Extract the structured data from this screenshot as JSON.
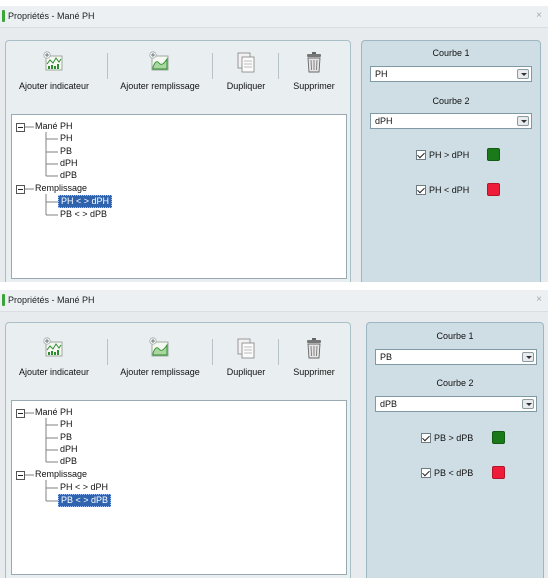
{
  "dialogs": [
    {
      "title": "Propriétés - Mané PH",
      "close": "×",
      "toolbar": {
        "add_indicator": "Ajouter indicateur",
        "add_fill": "Ajouter remplissage",
        "duplicate": "Dupliquer",
        "delete": "Supprimer"
      },
      "tree": {
        "root": "Mané PH",
        "children": [
          "PH",
          "PB",
          "dPH",
          "dPB"
        ],
        "fill_root": "Remplissage",
        "fill_children": [
          "PH < > dPH",
          "PB < > dPB"
        ],
        "selected_fill": 0
      },
      "right": {
        "curve1_label": "Courbe 1",
        "curve1_value": "PH",
        "curve2_label": "Courbe 2",
        "curve2_value": "dPH",
        "check1_label": "PH > dPH",
        "check1_checked": true,
        "check1_color": "#1a7a1a",
        "check2_label": "PH < dPH",
        "check2_checked": true,
        "check2_color": "#ee1c38"
      }
    },
    {
      "title": "Propriétés - Mané PH",
      "close": "×",
      "toolbar": {
        "add_indicator": "Ajouter indicateur",
        "add_fill": "Ajouter remplissage",
        "duplicate": "Dupliquer",
        "delete": "Supprimer"
      },
      "tree": {
        "root": "Mané PH",
        "children": [
          "PH",
          "PB",
          "dPH",
          "dPB"
        ],
        "fill_root": "Remplissage",
        "fill_children": [
          "PH < > dPH",
          "PB < > dPB"
        ],
        "selected_fill": 1
      },
      "right": {
        "curve1_label": "Courbe 1",
        "curve1_value": "PB",
        "curve2_label": "Courbe 2",
        "curve2_value": "dPB",
        "check1_label": "PB > dPB",
        "check1_checked": true,
        "check1_color": "#1a7a1a",
        "check2_label": "PB < dPB",
        "check2_checked": true,
        "check2_color": "#ee1c38"
      }
    }
  ],
  "icons": {
    "add_indicator": "chart-add-indicator-icon",
    "add_fill": "chart-add-fill-icon",
    "duplicate": "duplicate-pages-icon",
    "delete": "trash-bin-icon",
    "expand": "tree-collapse-box-icon"
  }
}
